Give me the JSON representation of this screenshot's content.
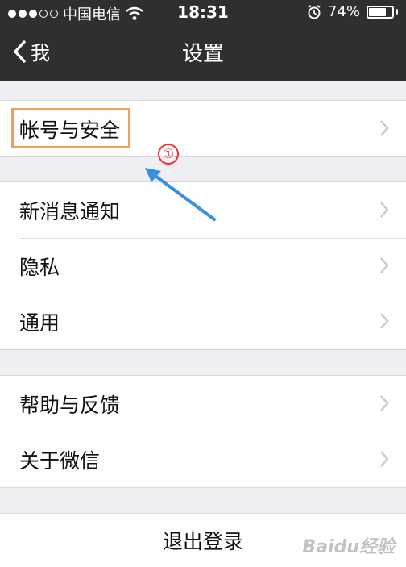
{
  "status_bar": {
    "carrier": "中国电信",
    "time": "18:31",
    "battery_level": 0.74,
    "battery_text": "74%"
  },
  "nav": {
    "back_label": "我",
    "title": "设置"
  },
  "groups": [
    {
      "items": [
        {
          "label": "帐号与安全"
        }
      ]
    },
    {
      "items": [
        {
          "label": "新消息通知"
        },
        {
          "label": "隐私"
        },
        {
          "label": "通用"
        }
      ]
    },
    {
      "items": [
        {
          "label": "帮助与反馈"
        },
        {
          "label": "关于微信"
        }
      ]
    }
  ],
  "logout_label": "退出登录",
  "annotation": {
    "marker": "①",
    "highlight_color": "#f0a05a",
    "marker_color": "#e33333",
    "arrow_color": "#3a8fe0"
  },
  "watermark": "Baidu经验"
}
